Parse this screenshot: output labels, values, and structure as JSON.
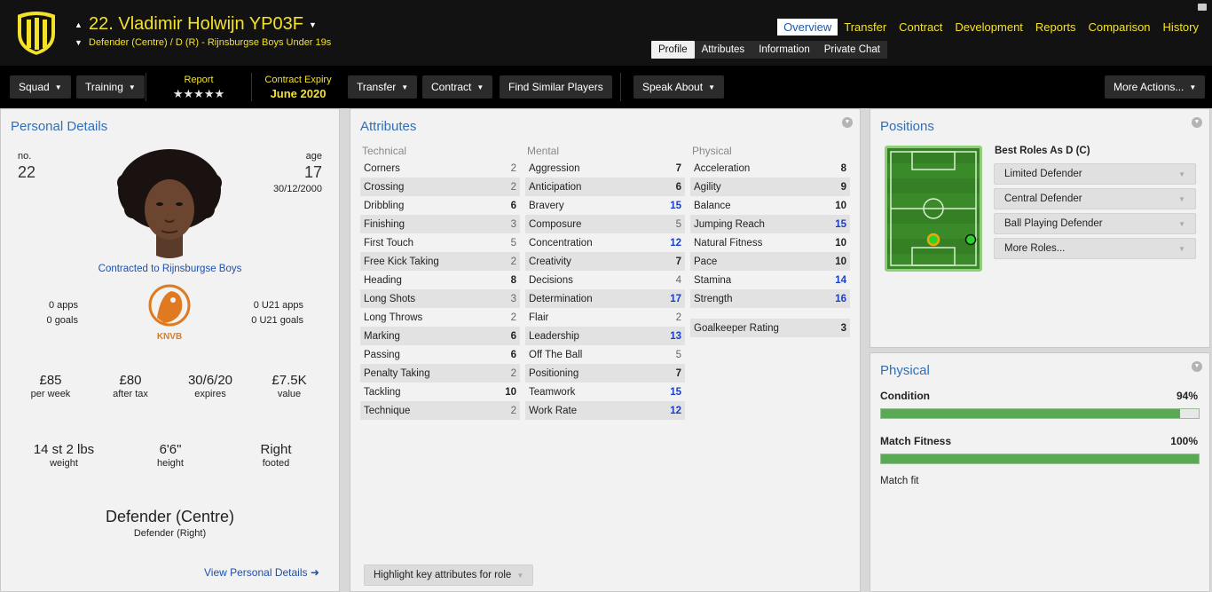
{
  "header": {
    "player_name": "22. Vladimir Holwijn YP03F",
    "subtitle": "Defender (Centre) / D (R) - Rijnsburgse Boys Under 19s",
    "nav": [
      "Overview",
      "Transfer",
      "Contract",
      "Development",
      "Reports",
      "Comparison",
      "History"
    ],
    "nav_active": "Overview",
    "subnav": [
      "Profile",
      "Attributes",
      "Information",
      "Private Chat"
    ],
    "subnav_active": "Profile",
    "club_colors": {
      "primary": "#f4e22a",
      "secondary": "#111111"
    }
  },
  "toolbar": {
    "squad": "Squad",
    "training": "Training",
    "report_label": "Report",
    "report_stars": "★★★★★",
    "report_rating": 4.5,
    "contract_expiry_label": "Contract Expiry",
    "contract_expiry_value": "June 2020",
    "transfer": "Transfer",
    "contract": "Contract",
    "find_similar": "Find Similar Players",
    "speak_about": "Speak About",
    "more_actions": "More Actions..."
  },
  "personal": {
    "title": "Personal Details",
    "no_label": "no.",
    "no_value": "22",
    "age_label": "age",
    "age_value": "17",
    "dob": "30/12/2000",
    "contracted": "Contracted to Rijnsburgse Boys",
    "apps": "0 apps",
    "goals": "0 goals",
    "u21_apps": "0 U21 apps",
    "u21_goals": "0 U21 goals",
    "nation_badge_text": "KNVB",
    "finance": [
      {
        "value": "£85",
        "label": "per week"
      },
      {
        "value": "£80",
        "label": "after tax"
      },
      {
        "value": "30/6/20",
        "label": "expires"
      },
      {
        "value": "£7.5K",
        "label": "value"
      }
    ],
    "physique": [
      {
        "value": "14 st 2 lbs",
        "label": "weight"
      },
      {
        "value": "6'6\"",
        "label": "height"
      },
      {
        "value": "Right",
        "label": "footed"
      }
    ],
    "position_main": "Defender (Centre)",
    "position_sub": "Defender (Right)",
    "view_link": "View Personal Details"
  },
  "attributes": {
    "title": "Attributes",
    "technical_label": "Technical",
    "mental_label": "Mental",
    "physical_label": "Physical",
    "technical": [
      {
        "name": "Corners",
        "value": "2"
      },
      {
        "name": "Crossing",
        "value": "2"
      },
      {
        "name": "Dribbling",
        "value": "6"
      },
      {
        "name": "Finishing",
        "value": "3"
      },
      {
        "name": "First Touch",
        "value": "5"
      },
      {
        "name": "Free Kick Taking",
        "value": "2"
      },
      {
        "name": "Heading",
        "value": "8"
      },
      {
        "name": "Long Shots",
        "value": "3"
      },
      {
        "name": "Long Throws",
        "value": "2"
      },
      {
        "name": "Marking",
        "value": "6"
      },
      {
        "name": "Passing",
        "value": "6"
      },
      {
        "name": "Penalty Taking",
        "value": "2"
      },
      {
        "name": "Tackling",
        "value": "10"
      },
      {
        "name": "Technique",
        "value": "2"
      }
    ],
    "mental": [
      {
        "name": "Aggression",
        "value": "7"
      },
      {
        "name": "Anticipation",
        "value": "6"
      },
      {
        "name": "Bravery",
        "value": "15"
      },
      {
        "name": "Composure",
        "value": "5"
      },
      {
        "name": "Concentration",
        "value": "12"
      },
      {
        "name": "Creativity",
        "value": "7"
      },
      {
        "name": "Decisions",
        "value": "4"
      },
      {
        "name": "Determination",
        "value": "17"
      },
      {
        "name": "Flair",
        "value": "2"
      },
      {
        "name": "Leadership",
        "value": "13"
      },
      {
        "name": "Off The Ball",
        "value": "5"
      },
      {
        "name": "Positioning",
        "value": "7"
      },
      {
        "name": "Teamwork",
        "value": "15"
      },
      {
        "name": "Work Rate",
        "value": "12"
      }
    ],
    "physical": [
      {
        "name": "Acceleration",
        "value": "8"
      },
      {
        "name": "Agility",
        "value": "9"
      },
      {
        "name": "Balance",
        "value": "10"
      },
      {
        "name": "Jumping Reach",
        "value": "15"
      },
      {
        "name": "Natural Fitness",
        "value": "10"
      },
      {
        "name": "Pace",
        "value": "10"
      },
      {
        "name": "Stamina",
        "value": "14"
      },
      {
        "name": "Strength",
        "value": "16"
      }
    ],
    "goalkeeper_label": "Goalkeeper Rating",
    "goalkeeper_value": "3",
    "highlight_button": "Highlight key attributes for role"
  },
  "positions": {
    "title": "Positions",
    "best_roles_label": "Best Roles As D (C)",
    "roles": [
      "Limited Defender",
      "Central Defender",
      "Ball Playing Defender",
      "More Roles..."
    ]
  },
  "physical": {
    "title": "Physical",
    "condition_label": "Condition",
    "condition_value": "94%",
    "condition_fraction": 0.94,
    "fitness_label": "Match Fitness",
    "fitness_value": "100%",
    "fitness_fraction": 1.0,
    "match_fit": "Match fit"
  }
}
